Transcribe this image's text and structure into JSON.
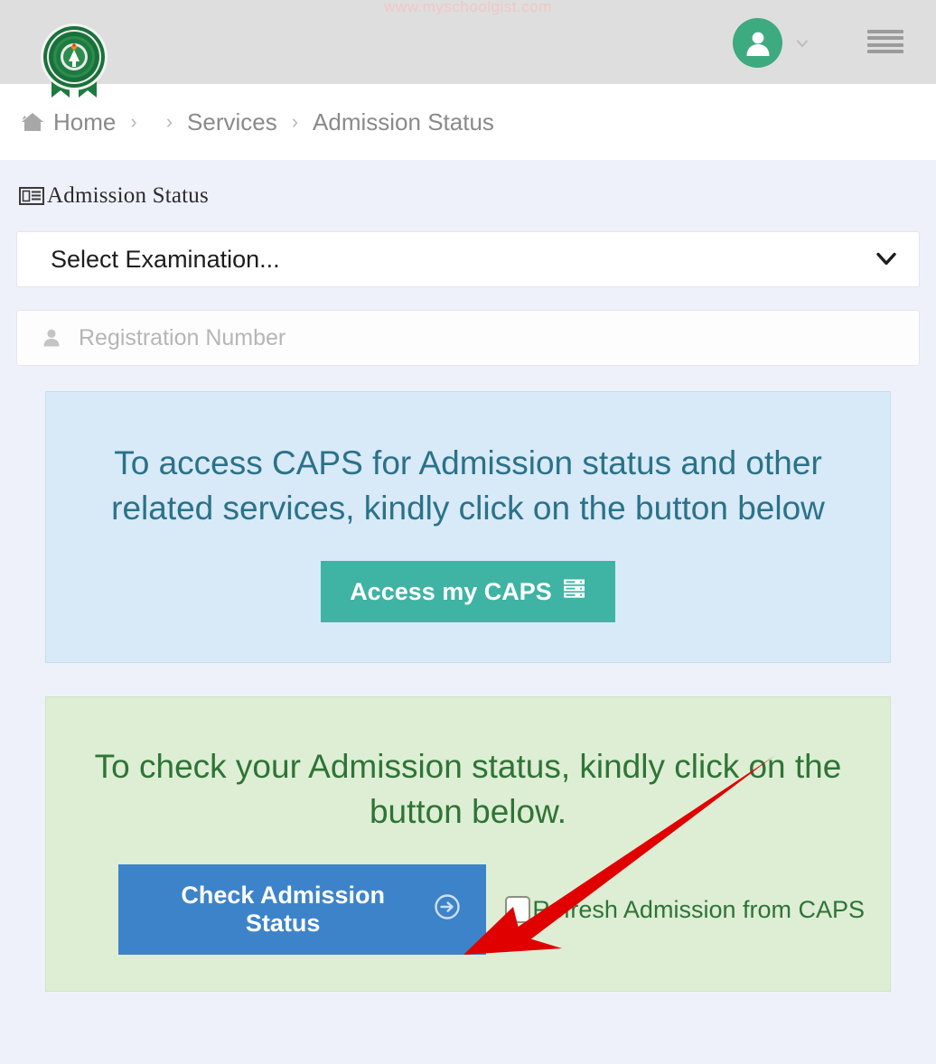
{
  "header": {
    "watermark": "www.myschoolgist.com",
    "logo_icon": "jamb-seal-logo",
    "avatar_icon": "user-avatar-icon",
    "chevron_icon": "chevron-down-icon",
    "menu_icon": "hamburger-menu-icon",
    "avatar_color": "#3daa7f",
    "background": "#dedede"
  },
  "breadcrumb": {
    "home_icon": "home-icon",
    "items": [
      {
        "label": "Home"
      },
      {
        "label": ""
      },
      {
        "label": "Services"
      },
      {
        "label": "Admission Status"
      }
    ],
    "separator": "›"
  },
  "page": {
    "title": "Admission Status",
    "title_icon": "newspaper-icon",
    "background": "#eef1fa"
  },
  "form": {
    "exam_select": {
      "value": "Select Examination...",
      "icon": "chevron-down-icon"
    },
    "registration": {
      "placeholder": "Registration Number",
      "value": "",
      "icon": "user-icon"
    }
  },
  "caps_panel": {
    "message": "To access CAPS for Admission status and other related services, kindly click on the button below",
    "button_label": "Access my CAPS",
    "button_icon": "server-stack-icon",
    "button_color": "#3fb3a4",
    "background": "#d8e9f7",
    "text_color": "#2a7289"
  },
  "status_panel": {
    "message": "To check your Admission status, kindly click on the button below.",
    "button_label": "Check Admission Status",
    "button_icon": "arrow-circle-right-icon",
    "button_color": "#3d83c9",
    "checkbox_label": "Refresh Admission from CAPS",
    "checkbox_checked": false,
    "background": "#ddeed4",
    "text_color": "#2e7436"
  },
  "annotation": {
    "arrow_color": "#e00000",
    "arrow_name": "red-pointer-arrow"
  }
}
